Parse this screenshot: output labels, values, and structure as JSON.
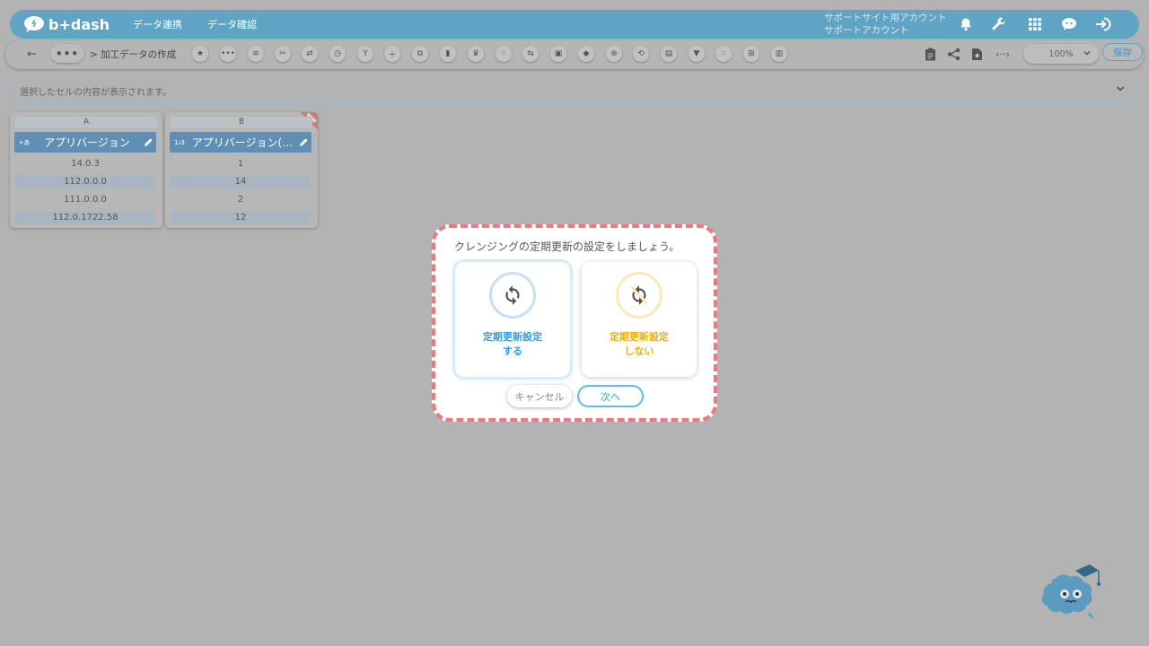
{
  "header": {
    "logo_text": "b+dash",
    "nav": [
      "データ連携",
      "データ確認"
    ],
    "account_line1": "サポートサイト用アカウント",
    "account_line2": "サポートアカウント",
    "icons": [
      "bell-icon",
      "wrench-icon",
      "apps-grid-icon",
      "chat-bot-icon",
      "logout-icon"
    ]
  },
  "toolbar": {
    "back_symbol": "←",
    "ellipsis": "•••",
    "breadcrumb": "> 加工データの作成",
    "tool_icons": [
      "star-icon",
      "more-icon",
      "list-icon",
      "tools-icon",
      "split-icon",
      "timer-icon",
      "merge-icon",
      "add-icon",
      "copy-icon",
      "delete-icon",
      "crown-icon",
      "expand-icon",
      "convert-icon",
      "lock-icon",
      "box-icon",
      "close-circle-icon",
      "replace-icon",
      "calc-icon",
      "filter-icon",
      "group-icon",
      "table-icon",
      "column-icon"
    ],
    "right_icons": [
      "clipboard-icon",
      "share-icon",
      "file-icon",
      "code-icon"
    ],
    "zoom": "100%",
    "save_label": "保存"
  },
  "formula_bar": {
    "placeholder": "選択したセルの内容が表示されます。"
  },
  "columns": [
    {
      "letter": "A",
      "type_label": "+あ",
      "name": "アプリバージョン",
      "cells": [
        "14.0.3",
        "112.0.0.0",
        "111.0.0.0",
        "112.0.1722.58"
      ],
      "is_new": false
    },
    {
      "letter": "B",
      "type_label": "1₂3",
      "name": "アプリバージョン(…",
      "cells": [
        "1",
        "14",
        "2",
        "12"
      ],
      "is_new": true,
      "new_label": "NEW"
    }
  ],
  "modal": {
    "title": "クレンジングの定期更新の設定をしましょう。",
    "option_on": {
      "line1": "定期更新設定",
      "line2": "する",
      "color": "#2f9fdf",
      "selected": true
    },
    "option_off": {
      "line1": "定期更新設定",
      "line2": "しない",
      "color": "#f2b100",
      "selected": false
    },
    "cancel_label": "キャンセル",
    "next_label": "次へ",
    "border_color": "#f07682"
  }
}
